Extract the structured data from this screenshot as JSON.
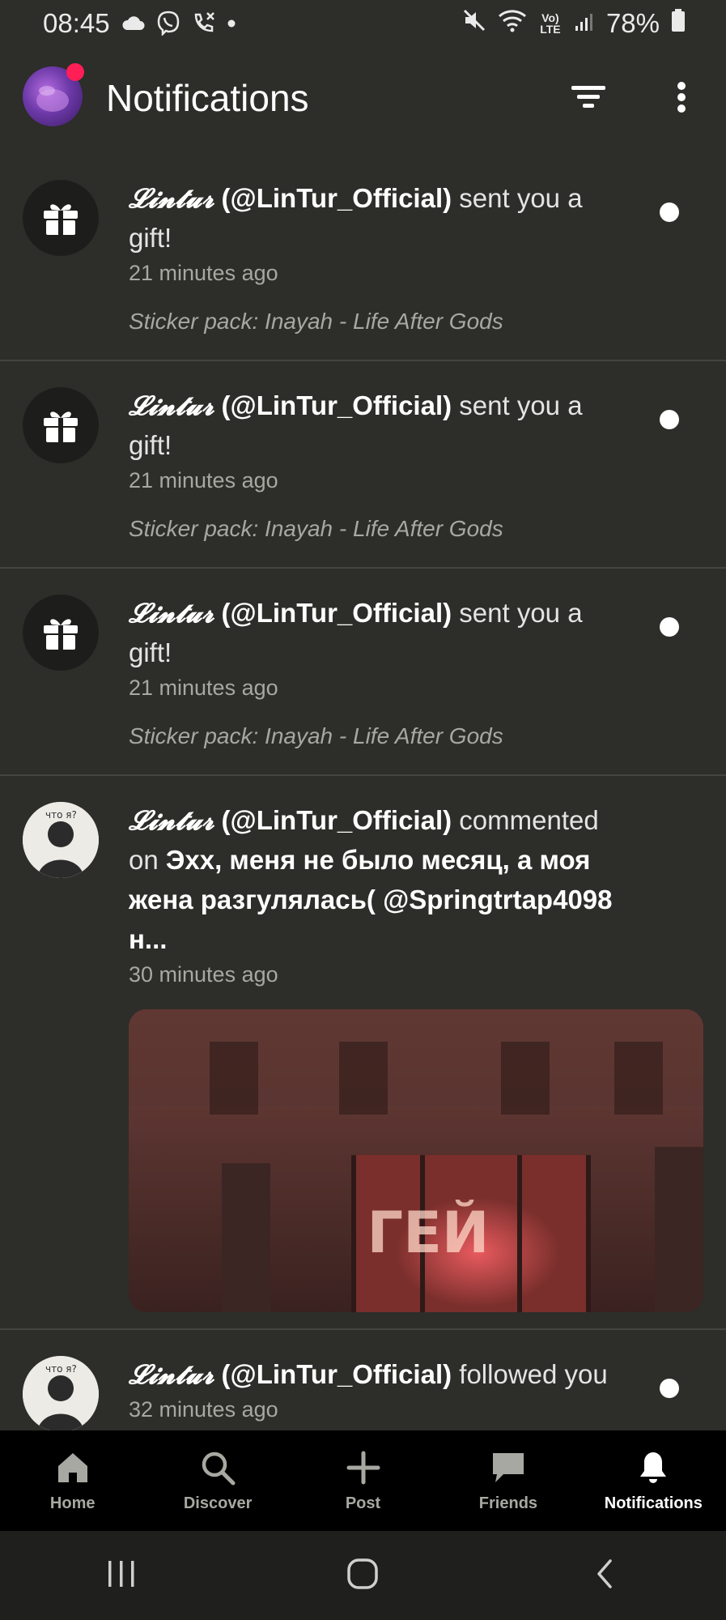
{
  "status_bar": {
    "time": "08:45",
    "battery": "78%",
    "network_label": "Vo) LTE",
    "icons": [
      "cloud-icon",
      "viber-icon",
      "missed-call-icon",
      "dot-icon",
      "mute-icon",
      "wifi-icon",
      "lte-icon",
      "signal-icon",
      "battery-icon"
    ]
  },
  "header": {
    "title": "Notifications",
    "icons": [
      "avatar",
      "filter-icon",
      "more-vert-icon"
    ]
  },
  "notifications": [
    {
      "type": "gift",
      "display_name": "𝓛𝓲𝓷𝓽𝓾𝓻",
      "handle": "(@LinTur_Official)",
      "action": "sent you a gift!",
      "time": "21 minutes ago",
      "detail": "Sticker pack: Inayah - Life After Gods",
      "unread": true
    },
    {
      "type": "gift",
      "display_name": "𝓛𝓲𝓷𝓽𝓾𝓻",
      "handle": "(@LinTur_Official)",
      "action": "sent you a gift!",
      "time": "21 minutes ago",
      "detail": "Sticker pack: Inayah - Life After Gods",
      "unread": true
    },
    {
      "type": "gift",
      "display_name": "𝓛𝓲𝓷𝓽𝓾𝓻",
      "handle": "(@LinTur_Official)",
      "action": "sent you a gift!",
      "time": "21 minutes ago",
      "detail": "Sticker pack: Inayah - Life After Gods",
      "unread": true
    },
    {
      "type": "comment",
      "display_name": "𝓛𝓲𝓷𝓽𝓾𝓻",
      "handle": "(@LinTur_Official)",
      "action": "commented on",
      "post_title": "Эхх, меня не было месяц, а моя жена разгулялась( @Springtrtap4098 н...",
      "time": "30 minutes ago",
      "image_text": "ГЕЙ",
      "unread": false
    },
    {
      "type": "follow",
      "display_name": "𝓛𝓲𝓷𝓽𝓾𝓻",
      "handle": "(@LinTur_Official)",
      "action": "followed you",
      "time": "32 minutes ago",
      "unread": true
    }
  ],
  "bottom_nav": [
    {
      "label": "Home",
      "icon": "home-icon",
      "active": false
    },
    {
      "label": "Discover",
      "icon": "search-icon",
      "active": false
    },
    {
      "label": "Post",
      "icon": "plus-icon",
      "active": false
    },
    {
      "label": "Friends",
      "icon": "chat-bubble-icon",
      "active": false
    },
    {
      "label": "Notifications",
      "icon": "bell-icon",
      "active": true
    }
  ],
  "system_nav": [
    "recents-icon",
    "home-circle-icon",
    "back-icon"
  ]
}
